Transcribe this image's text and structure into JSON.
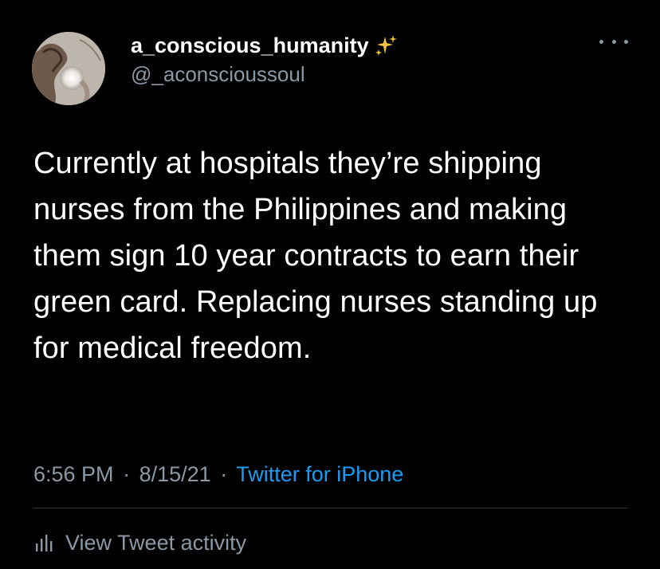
{
  "user": {
    "display_name": "a_conscious_humanity",
    "badge_emoji": "sparkles-icon",
    "handle": "@_aconscioussoul"
  },
  "tweet": {
    "text": "Currently at hospitals they’re shipping nurses from the Philippines and making them sign 10 year contracts to earn their green card. Replacing nurses standing up for medical freedom."
  },
  "meta": {
    "time": "6:56 PM",
    "separator": "·",
    "date": "8/15/21",
    "source": "Twitter for iPhone"
  },
  "activity": {
    "label": "View Tweet activity"
  },
  "colors": {
    "background": "#000000",
    "text_primary": "#ffffff",
    "text_secondary": "#8b98a5",
    "link": "#1d9bf0",
    "divider": "#2f3336"
  }
}
